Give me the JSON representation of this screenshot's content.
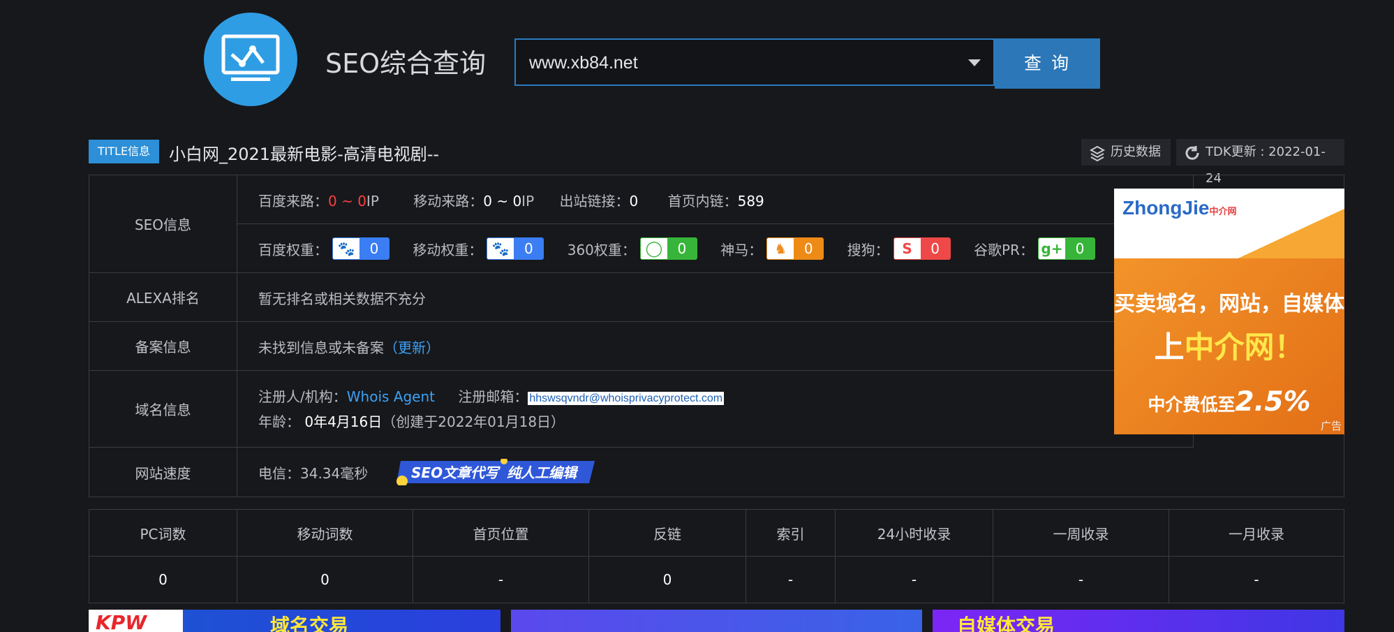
{
  "header": {
    "logo_icon": "monitor-chart-icon",
    "title": "SEO综合查询",
    "search": {
      "value": "www.xb84.net"
    },
    "query_button": "查 询"
  },
  "title_info": {
    "badge": "TITLE信息",
    "text": "小白网_2021最新电影-高清电视剧--",
    "history_label": "历史数据",
    "tdk_label": "TDK更新 : 2022-01-24"
  },
  "seo": {
    "label": "SEO信息",
    "baidu_source_label": "百度来路：",
    "baidu_source_value": "0 ~ 0",
    "ip": "IP",
    "mobile_source_label": "移动来路：",
    "mobile_source_value": "0 ~ 0",
    "outbound_label": "出站链接：",
    "outbound_value": "0",
    "internal_label": "首页内链：",
    "internal_value": "589",
    "weights": [
      {
        "label": "百度权重：",
        "value": "0",
        "color": "#3b7df3",
        "icon": "paw-icon"
      },
      {
        "label": "移动权重：",
        "value": "0",
        "color": "#3b7df3",
        "icon": "paw-icon"
      },
      {
        "label": "360权重：",
        "value": "0",
        "color": "#37b53a",
        "icon": "ring-icon"
      },
      {
        "label": "神马：",
        "value": "0",
        "color": "#ee8a16",
        "icon": "horse-icon"
      },
      {
        "label": "搜狗：",
        "value": "0",
        "color": "#ef4848",
        "icon": "sogou-icon"
      },
      {
        "label": "谷歌PR：",
        "value": "0",
        "color": "#37b53a",
        "icon": "google-plus-icon"
      }
    ]
  },
  "alexa": {
    "label": "ALEXA排名",
    "value": "暂无排名或相关数据不充分"
  },
  "icp": {
    "label": "备案信息",
    "value": "未找到信息或未备案",
    "refresh": "（更新）"
  },
  "domain": {
    "label": "域名信息",
    "registrant_label": "注册人/机构：",
    "registrant": "Whois Agent",
    "email_label": "注册邮箱：",
    "email": "hhswsqvndr@whoisprivacyprotect.com",
    "age_label": "年龄：",
    "age": "0年4月16日",
    "created": "（创建于2022年01月18日）"
  },
  "speed": {
    "label": "网站速度",
    "value": "电信：34.34毫秒",
    "promo_left": "SEO文章代写",
    "promo_right": "纯人工编辑"
  },
  "ad_right": {
    "logo": "ZhongJie",
    "logo_suffix": "中介网",
    "line1": "买卖域名，网站，自媒体",
    "line2_prefix": "上",
    "line2_highlight": "中介网！",
    "line3": "中介费低至",
    "line3_value": "2.5%",
    "ad_label": "广告"
  },
  "stats": {
    "headers": [
      "PC词数",
      "移动词数",
      "首页位置",
      "反链",
      "索引",
      "24小时收录",
      "一周收录",
      "一月收录"
    ],
    "values": [
      "0",
      "0",
      "-",
      "0",
      "-",
      "-",
      "-",
      "-"
    ]
  },
  "bottom_banners": {
    "left_brand": "KPW",
    "left_text": "域名交易",
    "right_text": "自媒体交易"
  }
}
